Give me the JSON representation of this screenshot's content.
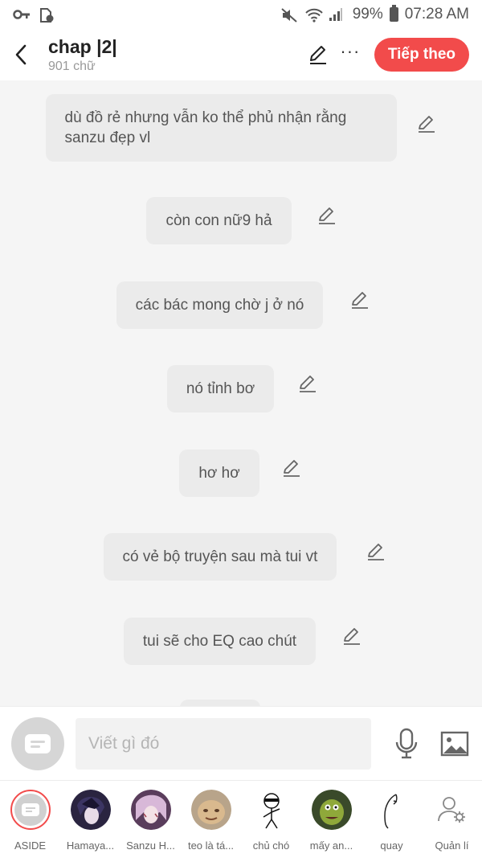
{
  "status_bar": {
    "battery": "99%",
    "time": "07:28 AM",
    "icons": [
      "key-icon",
      "sim-icon",
      "mute-icon",
      "wifi-icon",
      "signal-icon",
      "battery-icon"
    ]
  },
  "header": {
    "title": "chap |2|",
    "subtitle": "901 chữ",
    "next_label": "Tiếp theo"
  },
  "messages": [
    {
      "text": "dù đồ rẻ nhưng vẫn ko thể phủ nhận rằng sanzu đẹp vl"
    },
    {
      "text": "còn con nữ9 hả"
    },
    {
      "text": "các bác mong chờ j ở nó"
    },
    {
      "text": "nó tỉnh bơ"
    },
    {
      "text": "hơ hơ"
    },
    {
      "text": "có vẻ bộ truyện sau mà tui vt"
    },
    {
      "text": "tui sẽ cho EQ cao chút"
    }
  ],
  "composer": {
    "placeholder": "Viết gì đó"
  },
  "characters": [
    {
      "name": "ASIDE"
    },
    {
      "name": "Hamaya..."
    },
    {
      "name": "Sanzu H..."
    },
    {
      "name": "teo là tá..."
    },
    {
      "name": "chủ chó"
    },
    {
      "name": "mấy an..."
    },
    {
      "name": "quay"
    },
    {
      "name": "Quản lí"
    }
  ],
  "colors": {
    "accent": "#f24b4b",
    "bubble": "#ebebeb",
    "background": "#f5f5f5"
  }
}
